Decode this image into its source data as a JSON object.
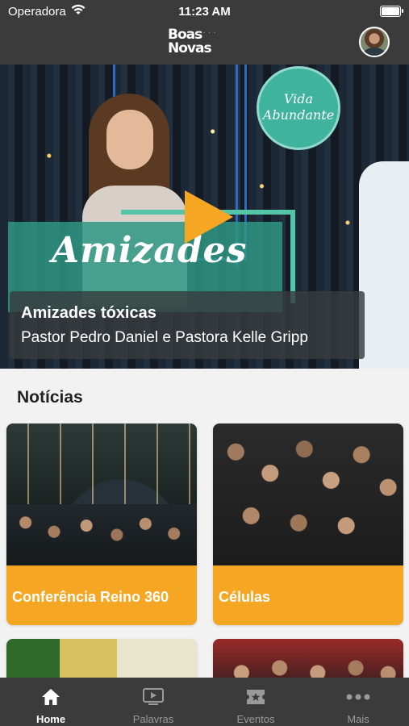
{
  "status_bar": {
    "carrier": "Operadora",
    "time": "11:23 AM"
  },
  "header": {
    "logo_line1": "Boas",
    "logo_line2": "Novas"
  },
  "hero": {
    "badge_line1": "Vida",
    "badge_line2": "Abundante",
    "overlay_text": "Amizades",
    "title": "Amizades tóxicas",
    "subtitle": "Pastor Pedro Daniel e Pastora Kelle Gripp"
  },
  "news": {
    "section_title": "Notícias",
    "cards": [
      {
        "label": "Conferência Reino 360"
      },
      {
        "label": "Células"
      },
      {
        "label": ""
      },
      {
        "label": ""
      }
    ]
  },
  "tabbar": {
    "tabs": [
      {
        "label": "Home",
        "icon": "home-icon",
        "active": true
      },
      {
        "label": "Palavras",
        "icon": "video-icon",
        "active": false
      },
      {
        "label": "Eventos",
        "icon": "ticket-icon",
        "active": false
      },
      {
        "label": "Mais",
        "icon": "more-icon",
        "active": false
      }
    ]
  },
  "colors": {
    "accent": "#f5a623",
    "bar": "#3b3b3b",
    "teal": "#3fb39e"
  }
}
